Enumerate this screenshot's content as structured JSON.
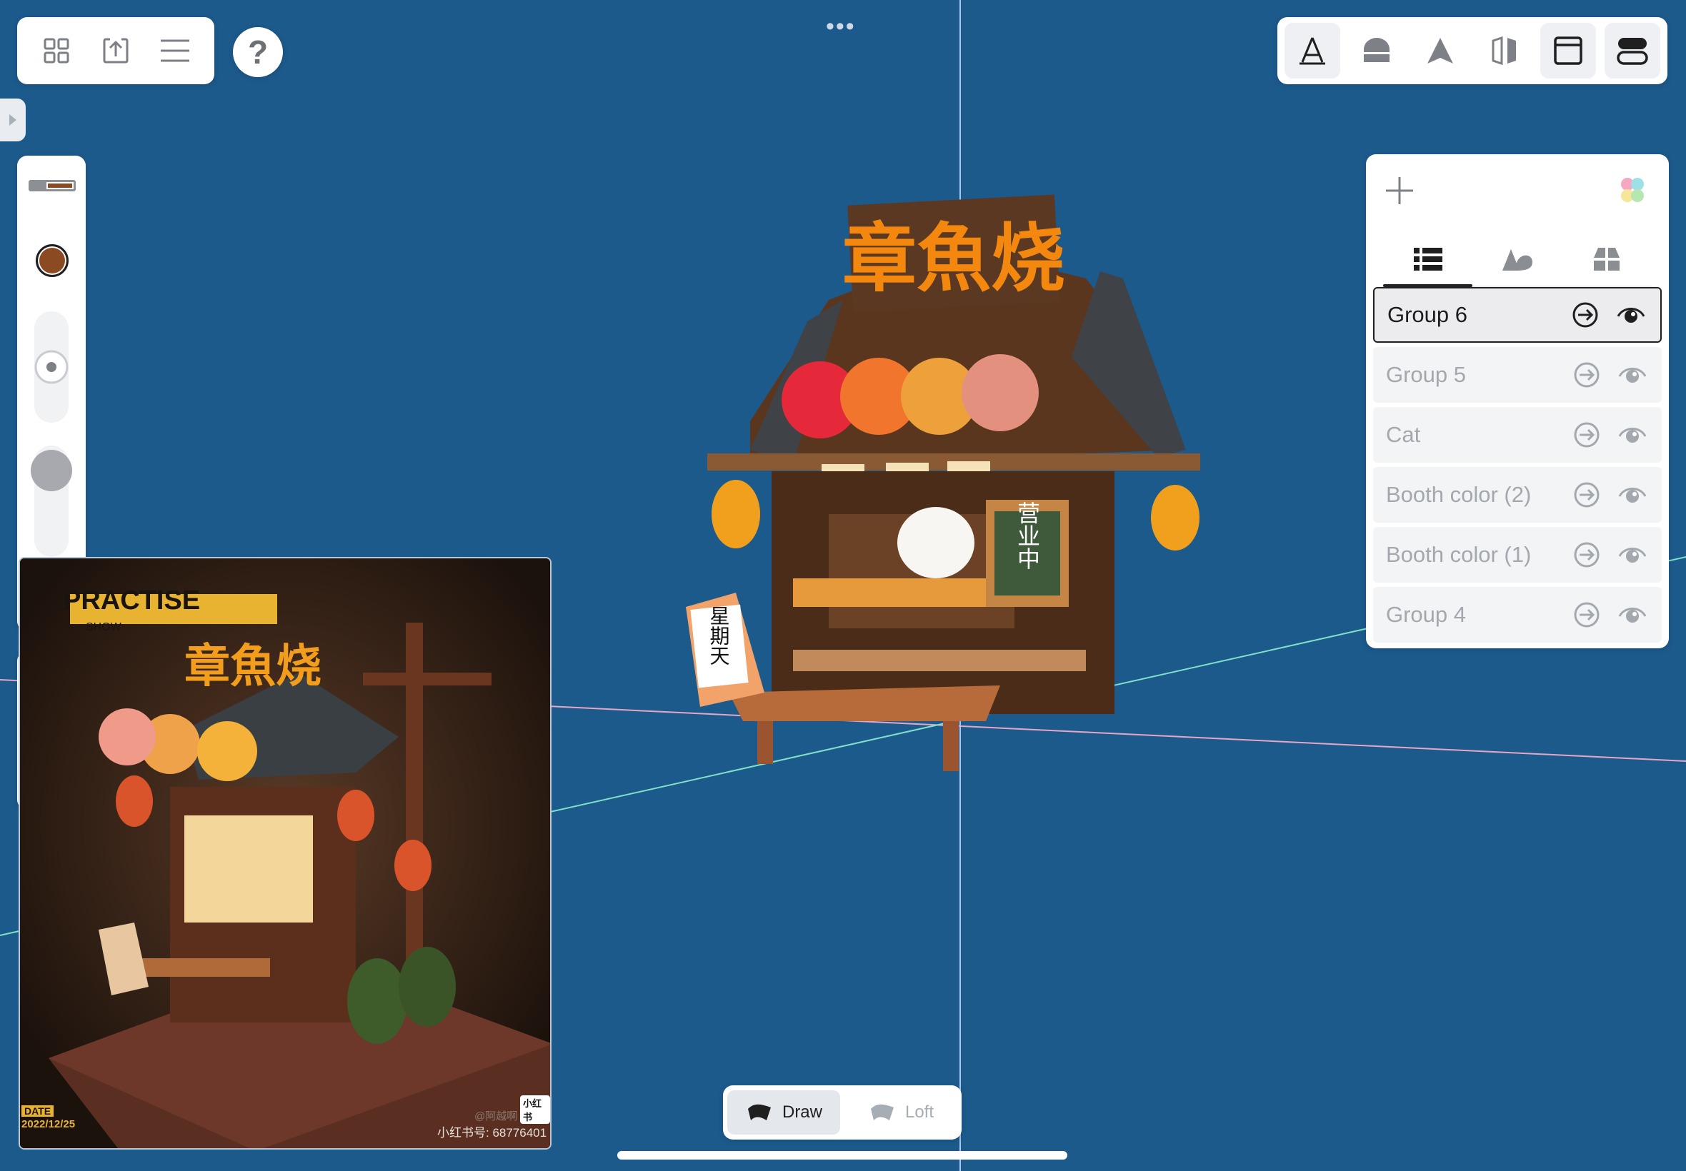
{
  "toolbar": {
    "more": "•••",
    "help": "?"
  },
  "tools": {
    "active_tab": "layers"
  },
  "reference_image": {
    "title": "PRACTISE",
    "subtitle": "SHOW",
    "sign_text": "章魚烧",
    "date_label": "DATE",
    "date_value": "2022/12/25",
    "credit": "@阿越啊",
    "account": "小红书号: 68776401",
    "badge": "小红书"
  },
  "model": {
    "sign_text": "章魚烧",
    "board_text": "营业中",
    "stand_text": "星期天"
  },
  "mode_switch": {
    "draw_label": "Draw",
    "loft_label": "Loft",
    "active": "Draw"
  },
  "layers": {
    "items": [
      {
        "name": "Group 6",
        "selected": true
      },
      {
        "name": "Group 5",
        "selected": false
      },
      {
        "name": "Cat",
        "selected": false
      },
      {
        "name": "Booth color (2)",
        "selected": false
      },
      {
        "name": "Booth color (1)",
        "selected": false
      },
      {
        "name": "Group 4",
        "selected": false
      }
    ]
  },
  "colors": {
    "canvas_bg": "#1c5a8c",
    "current_color": "#8b4a22",
    "axis_blue": "#a9c6f0",
    "axis_red": "#e7a6c3",
    "axis_green": "#7fe2c8"
  }
}
